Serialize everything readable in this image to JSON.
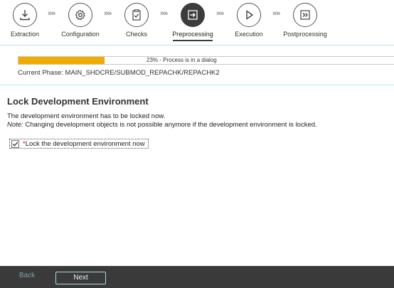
{
  "roadmap": {
    "steps": [
      {
        "label": "Extraction",
        "icon": "download-icon",
        "active": false
      },
      {
        "label": "Configuration",
        "icon": "gear-icon",
        "active": false
      },
      {
        "label": "Checks",
        "icon": "clipboard-check-icon",
        "active": false
      },
      {
        "label": "Preprocessing",
        "icon": "enter-icon",
        "active": true
      },
      {
        "label": "Execution",
        "icon": "play-icon",
        "active": false
      },
      {
        "label": "Postprocessing",
        "icon": "forward-icon",
        "active": false
      }
    ],
    "separator": "»»"
  },
  "progress": {
    "percent": 23,
    "text": "23% - Process is in a dialog",
    "fill_color": "#f0ab00"
  },
  "phase": {
    "text": "Current Phase: MAIN_SHDCRE/SUBMOD_REPACHK/REPACHK2"
  },
  "content": {
    "title": "Lock Development Environment",
    "line1": "The development environment has to be locked now.",
    "note_label": "Note:",
    "note_text": " Changing development objects is not possible anymore if the development environment is locked.",
    "checkbox": {
      "required_mark": "*",
      "label": "Lock the development environment now",
      "checked": true
    }
  },
  "footer": {
    "back_label": "Back",
    "next_label": "Next"
  }
}
